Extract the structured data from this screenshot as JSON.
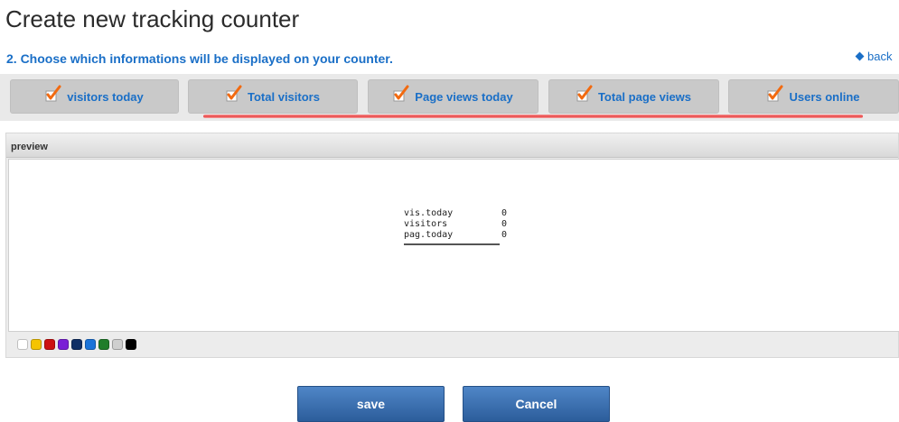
{
  "header": {
    "title": "Create new tracking counter",
    "subtitle": "2. Choose which informations will be displayed on your counter.",
    "back_label": "back"
  },
  "options": [
    {
      "label": "visitors today",
      "checked": true
    },
    {
      "label": "Total visitors",
      "checked": true
    },
    {
      "label": "Page views today",
      "checked": true
    },
    {
      "label": "Total page views",
      "checked": true
    },
    {
      "label": "Users online",
      "checked": true
    }
  ],
  "preview": {
    "label": "preview",
    "counter_rows": [
      {
        "label": "vis.today",
        "value": "0"
      },
      {
        "label": "visitors",
        "value": "0"
      },
      {
        "label": "pag.today",
        "value": "0"
      }
    ]
  },
  "color_swatches": [
    "#ffffff",
    "#f5c400",
    "#cc1111",
    "#7a1fd6",
    "#0f2f66",
    "#1a73d9",
    "#1f7d2a",
    "#cfcfcf",
    "#000000"
  ],
  "actions": {
    "save_label": "save",
    "cancel_label": "Cancel"
  },
  "colors": {
    "accent": "#1a6fc7",
    "check": "#f26a10",
    "button": "#3a6fae"
  }
}
